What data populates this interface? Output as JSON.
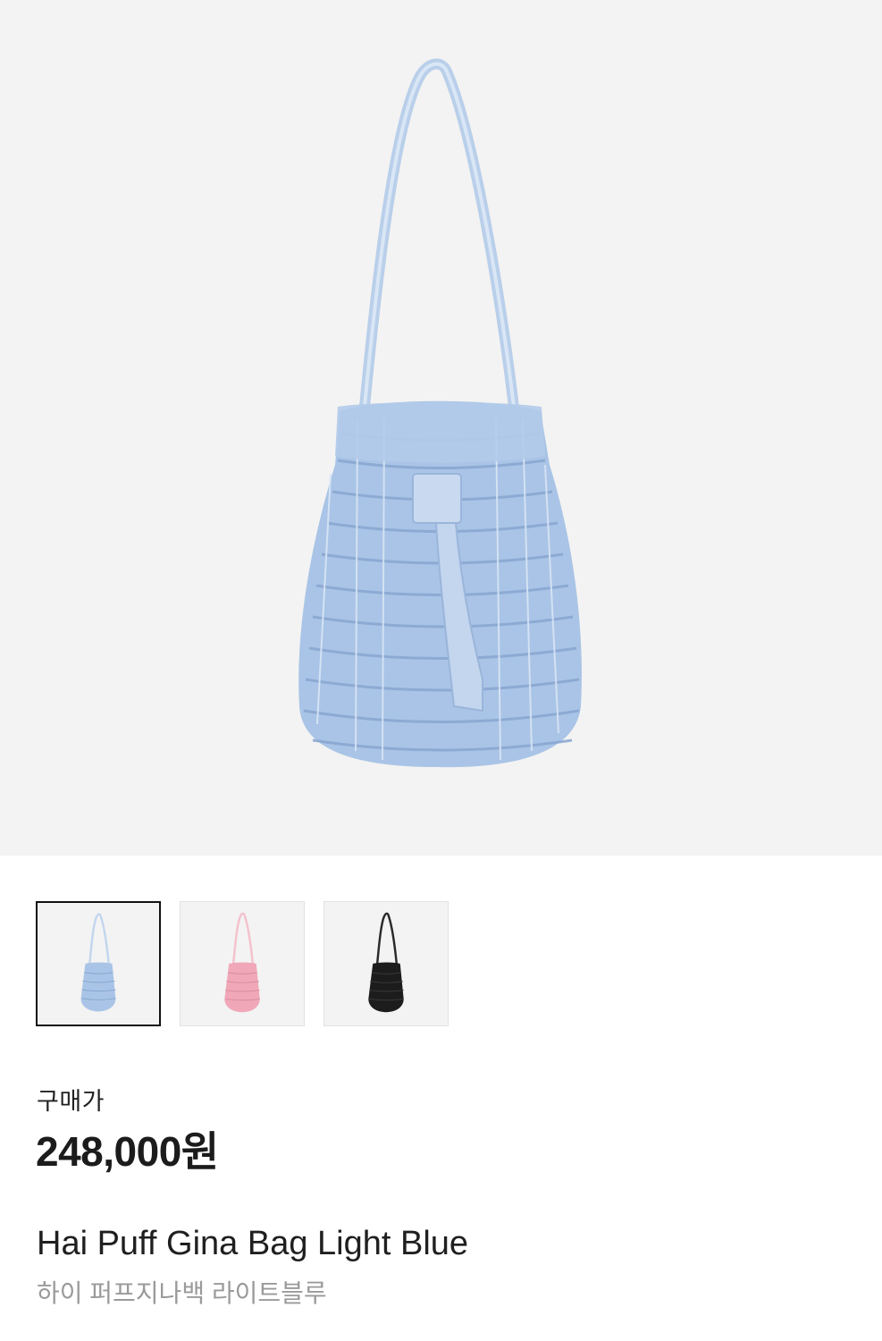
{
  "product": {
    "price_label": "구매가",
    "price": "248,000원",
    "name_en": "Hai Puff Gina Bag Light Blue",
    "name_ko": "하이 퍼프지나백 라이트블루"
  },
  "gallery": {
    "selected_index": 0,
    "thumbnails": [
      {
        "color_name": "light-blue",
        "bag_color": "#a9c4e6",
        "strap_color": "#c3d6ee"
      },
      {
        "color_name": "pink",
        "bag_color": "#f0a8b8",
        "strap_color": "#f3c2cd"
      },
      {
        "color_name": "black",
        "bag_color": "#1c1c1c",
        "strap_color": "#2a2a2a"
      }
    ]
  },
  "colors": {
    "hero_background": "#f3f3f3",
    "bag_main": "#a9c4e6",
    "bag_shadow": "#87a6d0",
    "bag_highlight": "#d8e5f5",
    "selected_border": "#111111"
  }
}
